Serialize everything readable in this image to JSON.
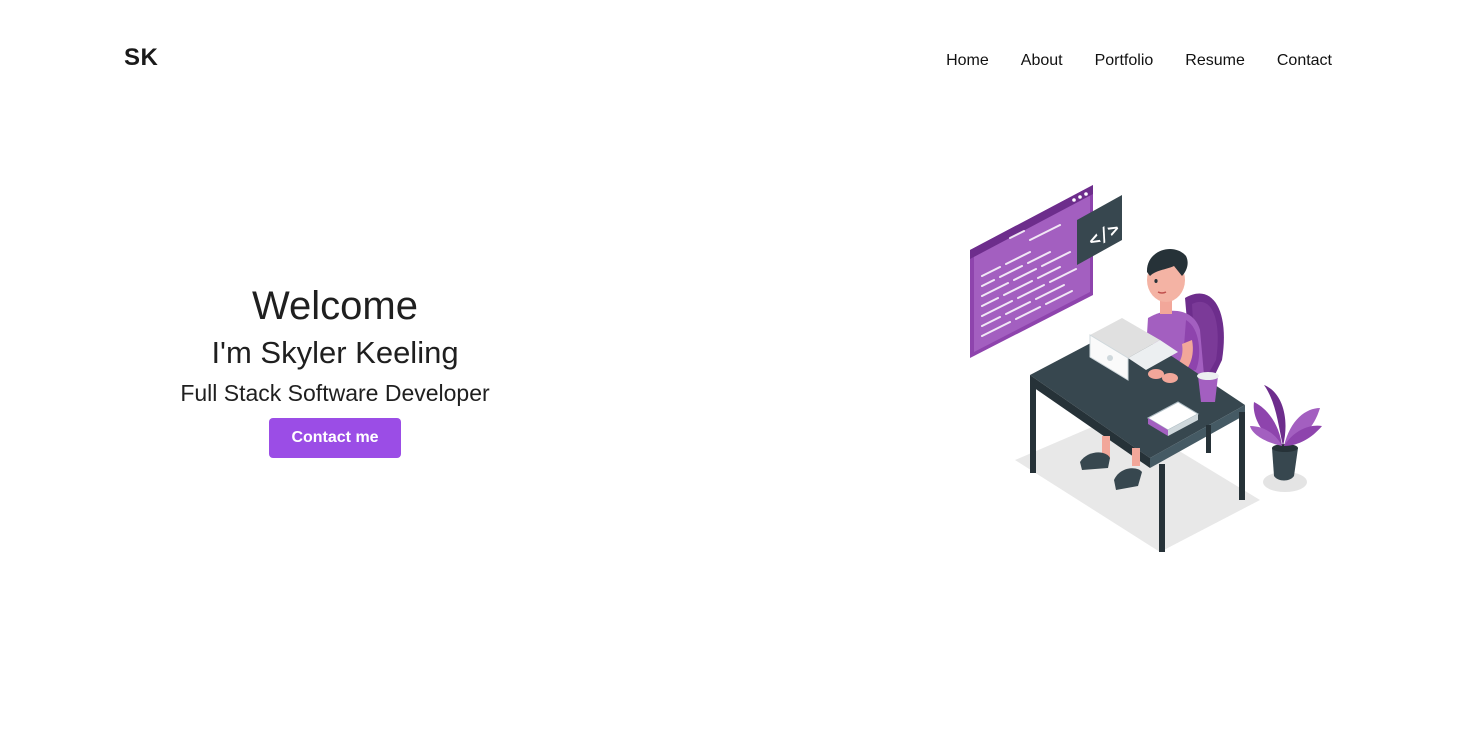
{
  "header": {
    "logo": "SK",
    "nav": [
      "Home",
      "About",
      "Portfolio",
      "Resume",
      "Contact"
    ]
  },
  "hero": {
    "greeting": "Welcome",
    "name_line": "I'm Skyler Keeling",
    "role": "Full Stack Software Developer",
    "cta_label": "Contact me",
    "code_badge": "</>"
  },
  "colors": {
    "accent": "#9b4de6",
    "illustration_purple": "#a35fc0",
    "illustration_dark": "#37474f"
  }
}
